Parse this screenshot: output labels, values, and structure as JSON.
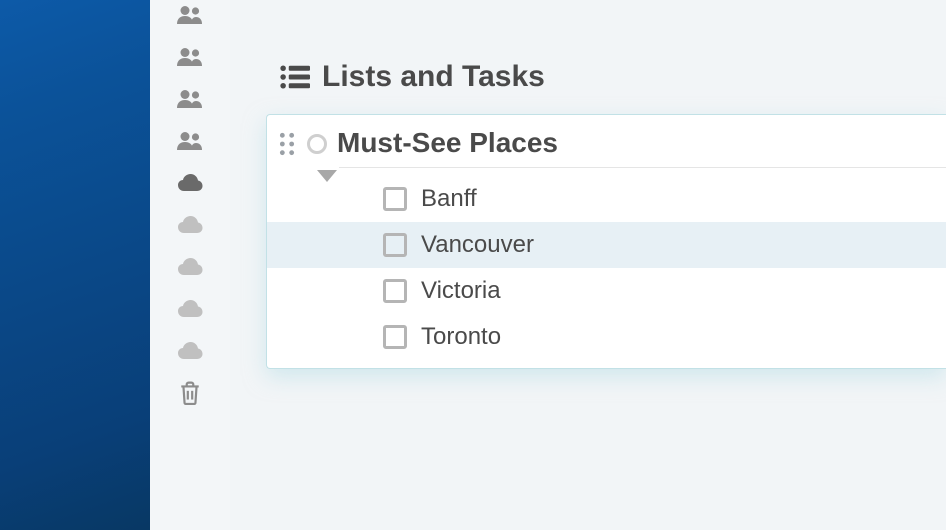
{
  "section": {
    "title": "Lists and Tasks"
  },
  "list": {
    "title": "Must-See Places",
    "tasks": [
      {
        "label": "Banff",
        "highlight": false
      },
      {
        "label": "Vancouver",
        "highlight": true
      },
      {
        "label": "Victoria",
        "highlight": false
      },
      {
        "label": "Toronto",
        "highlight": false
      }
    ]
  },
  "sidebar": {
    "icons": [
      {
        "name": "people-icon",
        "type": "people",
        "faded": false
      },
      {
        "name": "people-icon",
        "type": "people",
        "faded": false
      },
      {
        "name": "people-icon",
        "type": "people",
        "faded": false
      },
      {
        "name": "people-icon",
        "type": "people",
        "faded": false
      },
      {
        "name": "cloud-icon",
        "type": "cloud",
        "active": true
      },
      {
        "name": "cloud-icon",
        "type": "cloud",
        "faded": true
      },
      {
        "name": "cloud-icon",
        "type": "cloud",
        "faded": true
      },
      {
        "name": "cloud-icon",
        "type": "cloud",
        "faded": true
      },
      {
        "name": "cloud-icon",
        "type": "cloud",
        "faded": true
      },
      {
        "name": "trash-icon",
        "type": "trash",
        "faded": false
      }
    ]
  }
}
